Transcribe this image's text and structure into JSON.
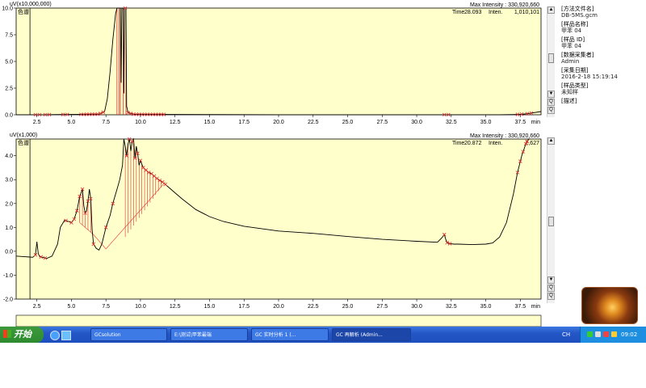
{
  "chart_data": [
    {
      "type": "line",
      "ylabel": "uV(x10,000,000)",
      "xlim": [
        1.0,
        39.0
      ],
      "ylim": [
        0.0,
        10.0
      ],
      "xticks": [
        2.5,
        5.0,
        7.5,
        10.0,
        12.5,
        15.0,
        17.5,
        20.0,
        22.5,
        25.0,
        27.5,
        30.0,
        32.5,
        35.0,
        37.5
      ],
      "xtick_labels": [
        "2.5",
        "5.0",
        "7.5",
        "10.0",
        "12.5",
        "15.0",
        "17.5",
        "20.0",
        "22.5",
        "25.0",
        "27.5",
        "30.0",
        "32.5",
        "35.0",
        "37.5"
      ],
      "yticks": [
        0.0,
        2.5,
        5.0,
        7.5,
        10.0
      ],
      "ytick_labels": [
        "0.0",
        "2.5",
        "5.0",
        "7.5",
        "10.0"
      ],
      "x_unit": "min",
      "legend": "色谱",
      "header": {
        "max_intensity": "Max Intensity : 330,920,660",
        "time_label": "Time",
        "time_value": "28.093",
        "inten_label": "Inten.",
        "inten_value": "1,010,101"
      },
      "series": [
        {
          "x": [
            1.0,
            2.0,
            3.0,
            4.0,
            5.0,
            6.0,
            7.0,
            7.4,
            7.6,
            7.8,
            8.0,
            8.2,
            8.3,
            8.35,
            8.45,
            8.55,
            8.6,
            8.65,
            8.75,
            8.8,
            8.85,
            8.95,
            9.0,
            9.1,
            9.5,
            10,
            15,
            20,
            25,
            30,
            35,
            36,
            37,
            37.5,
            38,
            39
          ],
          "y": [
            0.01,
            0.01,
            0.01,
            0.02,
            0.03,
            0.04,
            0.06,
            0.3,
            1.5,
            4.0,
            7.0,
            9.5,
            12,
            15,
            15,
            15,
            3,
            15,
            15,
            2,
            15,
            15,
            0.8,
            0.2,
            0.05,
            0.04,
            0.02,
            0.01,
            0.01,
            0.01,
            0.01,
            0.01,
            0.02,
            0.04,
            0.1,
            0.3
          ]
        }
      ],
      "markers_x": [
        2.4,
        2.7,
        3.1,
        3.4,
        4.4,
        4.7,
        5.7,
        5.9,
        6.1,
        6.3,
        6.5,
        6.7,
        6.9,
        7.1,
        7.3,
        8.9,
        9.1,
        9.3,
        9.5,
        9.7,
        9.9,
        10.1,
        10.3,
        10.5,
        10.7,
        10.9,
        11.1,
        11.3,
        11.5,
        11.7,
        32.0,
        32.3,
        37.3,
        37.6,
        38.0,
        38.3
      ]
    },
    {
      "type": "line",
      "ylabel": "uV(x1,000)",
      "xlim": [
        1.0,
        39.0
      ],
      "ylim": [
        -2.0,
        4.7
      ],
      "xticks": [
        2.5,
        5.0,
        7.5,
        10.0,
        12.5,
        15.0,
        17.5,
        20.0,
        22.5,
        25.0,
        27.5,
        30.0,
        32.5,
        35.0,
        37.5
      ],
      "xtick_labels": [
        "2.5",
        "5.0",
        "7.5",
        "10.0",
        "12.5",
        "15.0",
        "17.5",
        "20.0",
        "22.5",
        "25.0",
        "27.5",
        "30.0",
        "32.5",
        "35.0",
        "37.5"
      ],
      "yticks": [
        -2.0,
        -1.0,
        0.0,
        1.0,
        2.0,
        3.0,
        4.0
      ],
      "ytick_labels": [
        "-2.0",
        "-1.0",
        "0.0",
        "1.0",
        "2.0",
        "3.0",
        "4.0"
      ],
      "x_unit": "min",
      "legend": "色谱",
      "header": {
        "max_intensity": "Max Intensity : 330,920,660",
        "time_label": "Time",
        "time_value": "20.872",
        "inten_label": "Inten.",
        "inten_value": "2,627"
      },
      "series": [
        {
          "x": [
            1.0,
            1.5,
            2.0,
            2.2,
            2.4,
            2.5,
            2.6,
            2.7,
            2.9,
            3.2,
            3.6,
            4.0,
            4.2,
            4.5,
            4.8,
            5.0,
            5.2,
            5.4,
            5.6,
            5.8,
            5.9,
            6.0,
            6.1,
            6.2,
            6.3,
            6.4,
            6.5,
            6.6,
            6.8,
            7.0,
            7.2,
            7.5,
            7.8,
            8.0,
            8.3,
            8.5,
            8.7,
            8.8,
            8.9,
            9.0,
            9.1,
            9.2,
            9.3,
            9.4,
            9.5,
            9.6,
            9.7,
            9.8,
            9.9,
            10.0,
            10.2,
            10.4,
            10.6,
            10.8,
            11.0,
            11.3,
            11.6,
            12.0,
            12.5,
            13.0,
            14.0,
            15.0,
            16.0,
            17.5,
            20.0,
            22.5,
            25.0,
            27.5,
            30.0,
            31.5,
            31.8,
            32.0,
            32.1,
            32.2,
            32.4,
            32.7,
            33.0,
            34.0,
            35.0,
            35.5,
            36.0,
            36.5,
            37.0,
            37.3,
            37.6,
            37.9,
            38.1,
            38.2
          ],
          "y": [
            -0.2,
            -0.22,
            -0.24,
            -0.25,
            -0.15,
            0.4,
            -0.1,
            -0.22,
            -0.25,
            -0.3,
            -0.2,
            0.3,
            1.0,
            1.3,
            1.25,
            1.2,
            1.35,
            1.7,
            2.3,
            2.6,
            1.9,
            1.6,
            1.7,
            2.1,
            2.6,
            2.2,
            0.9,
            0.3,
            0.12,
            0.05,
            0.3,
            1.0,
            1.5,
            2.0,
            2.6,
            3.0,
            3.6,
            4.7,
            4.4,
            4.0,
            4.5,
            4.7,
            4.2,
            4.6,
            4.7,
            3.9,
            4.4,
            4.1,
            3.6,
            3.8,
            3.5,
            3.4,
            3.3,
            3.25,
            3.15,
            3.0,
            2.9,
            2.7,
            2.45,
            2.2,
            1.75,
            1.45,
            1.25,
            1.05,
            0.85,
            0.75,
            0.62,
            0.5,
            0.42,
            0.38,
            0.55,
            0.7,
            0.5,
            0.36,
            0.32,
            0.3,
            0.3,
            0.28,
            0.3,
            0.35,
            0.6,
            1.2,
            2.4,
            3.3,
            4.0,
            4.5,
            4.7,
            4.7
          ]
        }
      ],
      "markers_x": [
        2.4,
        2.8,
        3.1,
        4.6,
        5.0,
        5.2,
        5.4,
        5.6,
        5.8,
        6.0,
        6.2,
        6.4,
        6.6,
        7.5,
        8.0,
        9.0,
        9.2,
        9.4,
        9.6,
        9.8,
        10.0,
        10.2,
        10.4,
        10.6,
        10.8,
        11.0,
        11.2,
        11.4,
        11.6,
        11.8,
        32.0,
        32.2,
        32.4,
        37.3,
        37.5,
        37.7,
        37.9,
        38.0
      ]
    }
  ],
  "side_panel": {
    "method_label": "[方法文件名]",
    "method_value": "DB-5MS.gcm",
    "sample_name_label": "[样品名称]",
    "sample_name_value": "甲苯 04",
    "sample_id_label": "[样品 ID]",
    "sample_id_value": "甲苯 04",
    "operator_label": "[数据采集者]",
    "operator_value": "Admin",
    "date_label": "[采集日期]",
    "date_value": "2016-2-18 15:19:14",
    "type_label": "[样品类型]",
    "type_value": "未知样",
    "desc_label": "[描述]"
  },
  "scroll_buttons": {
    "up": "▲",
    "down": "▼",
    "zoom_in": "Q",
    "zoom_out": "Q"
  },
  "taskbar": {
    "start_label": "开始",
    "tasks": [
      {
        "label": "GCsolution"
      },
      {
        "label": "E:\\测试\\甲苯最端"
      },
      {
        "label": "GC 实时分析 1 (..."
      },
      {
        "label": "GC 再解析 (Admin..."
      }
    ],
    "ime": "CH",
    "clock": "09:02"
  },
  "colors": {
    "plot_bg": "#ffffcc",
    "trace": "#000000",
    "marker": "#e03030",
    "taskbar": "#2457c7",
    "start": "#2e8a2e"
  }
}
